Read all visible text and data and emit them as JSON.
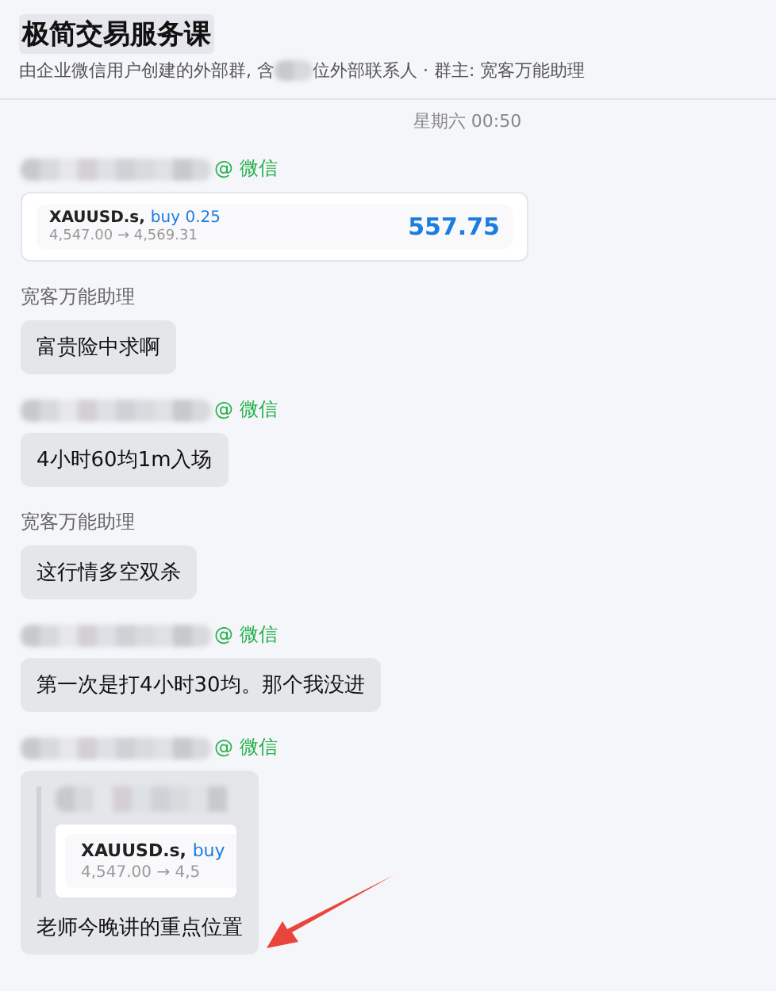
{
  "header": {
    "title": "极简交易服务课",
    "subtitle_before": "由企业微信用户创建的外部群, 含",
    "subtitle_after": "位外部联系人 · 群主: 宽客万能助理"
  },
  "timestamp": "星期六 00:50",
  "messages": [
    {
      "kind": "card",
      "sender": {
        "redacted": true,
        "tag": "@ 微信"
      },
      "card": {
        "symbol": "XAUUSD.s,",
        "side": "buy 0.25",
        "prices": "4,547.00 → 4,569.31",
        "profit": "557.75"
      }
    },
    {
      "kind": "text",
      "sender": {
        "redacted": false,
        "name": "宽客万能助理"
      },
      "text": "富贵险中求啊"
    },
    {
      "kind": "text",
      "sender": {
        "redacted": true,
        "tag": "@ 微信"
      },
      "text": "4小时60均1m入场"
    },
    {
      "kind": "text",
      "sender": {
        "redacted": false,
        "name": "宽客万能助理"
      },
      "text": "这行情多空双杀"
    },
    {
      "kind": "text",
      "sender": {
        "redacted": true,
        "tag": "@ 微信"
      },
      "text": "第一次是打4小时30均。那个我没进"
    },
    {
      "kind": "quote",
      "sender": {
        "redacted": true,
        "tag": "@ 微信"
      },
      "quote": {
        "symbol": "XAUUSD.s,",
        "side": "buy",
        "prices": "4,547.00 → 4,5"
      },
      "text": "老师今晚讲的重点位置",
      "annotated": true
    }
  ]
}
